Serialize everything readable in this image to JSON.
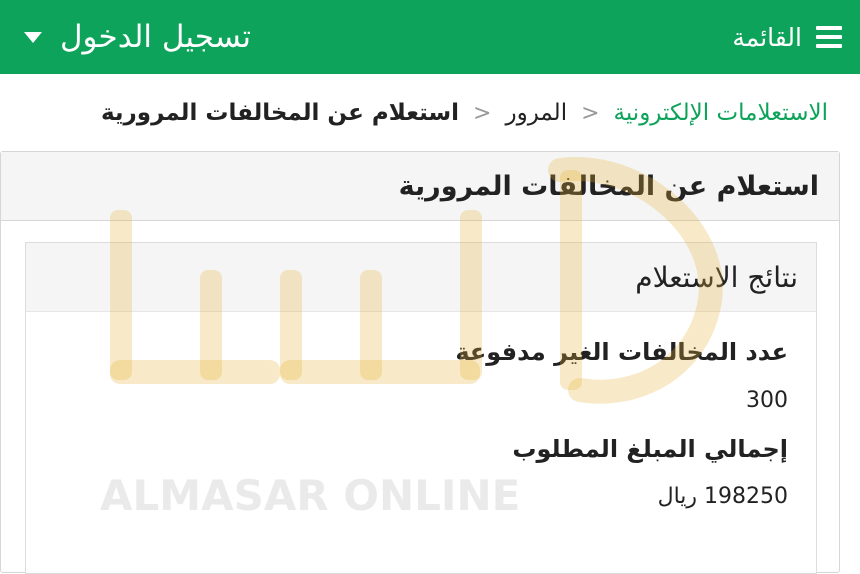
{
  "topbar": {
    "menu_label": "القائمة",
    "login_label": "تسجيل الدخول"
  },
  "breadcrumb": {
    "items": [
      "الاستعلامات الإلكترونية",
      "المرور",
      "استعلام عن المخالفات المرورية"
    ],
    "separator": "<"
  },
  "panel": {
    "title": "استعلام عن المخالفات المرورية"
  },
  "results": {
    "title": "نتائج الاستعلام",
    "unpaid_label": "عدد المخالفات الغير مدفوعة",
    "unpaid_value": "300",
    "total_label": "إجمالي المبلغ المطلوب",
    "total_value": "198250 ريال"
  },
  "watermark": {
    "text": "ALMASAR ONLINE"
  },
  "colors": {
    "brand_green": "#0ea35a",
    "watermark_gold": "#e7b43a"
  }
}
